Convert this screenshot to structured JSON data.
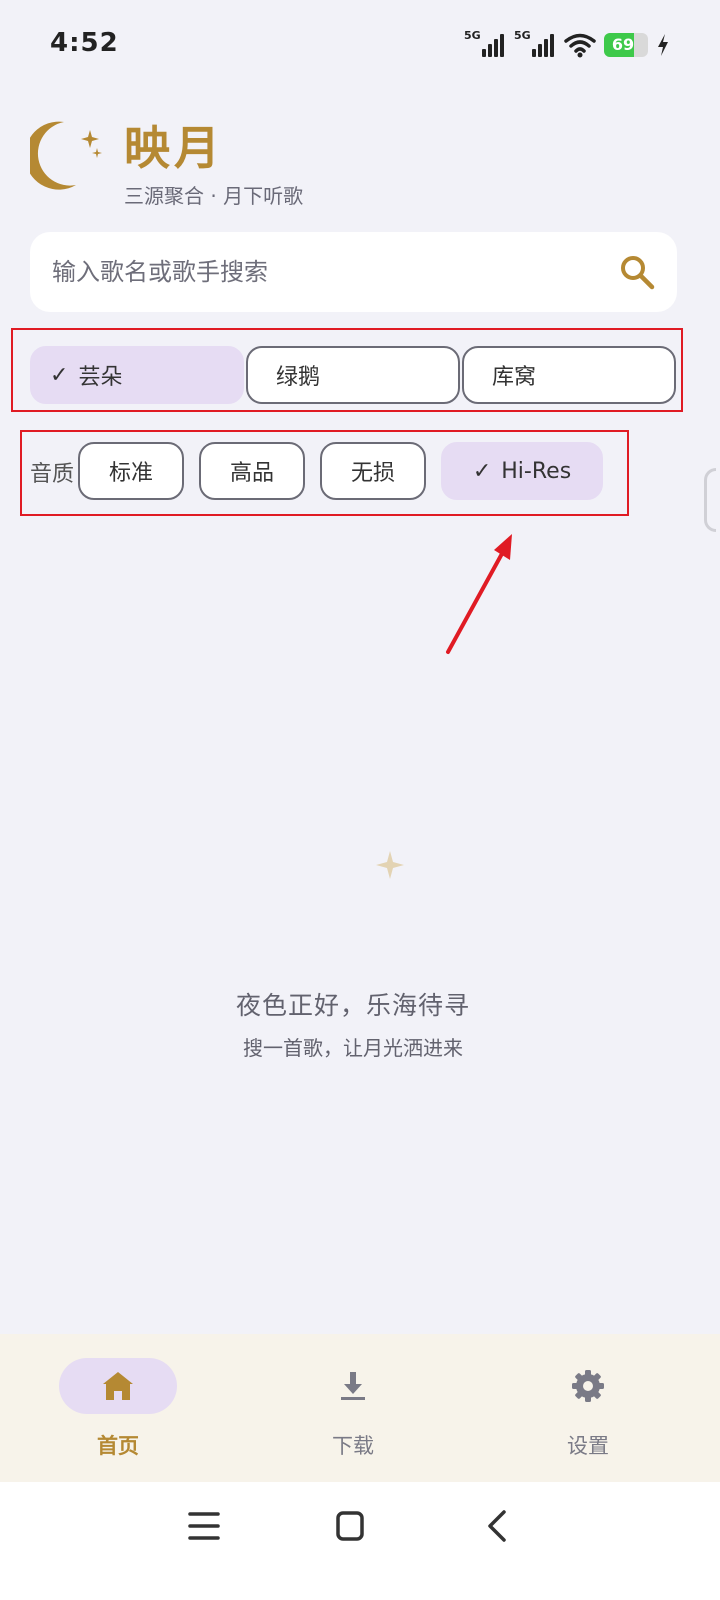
{
  "status_bar": {
    "time": "4:52",
    "signal_1_label": "5G",
    "signal_2_label": "5G",
    "battery_level": "69",
    "battery_fraction": 0.69,
    "icons": [
      "signal-icon",
      "signal-icon",
      "wifi-icon",
      "battery-icon",
      "charging-icon"
    ]
  },
  "header": {
    "title": "映月",
    "subtitle": "三源聚合 · 月下听歌",
    "logo_icon": "crescent-moon-icon"
  },
  "search": {
    "placeholder": "输入歌名或歌手搜索",
    "value": "",
    "icon": "search-icon"
  },
  "sources": [
    {
      "label": "芸朵",
      "selected": true
    },
    {
      "label": "绿鹅",
      "selected": false
    },
    {
      "label": "库窝",
      "selected": false
    }
  ],
  "quality": {
    "label": "音质",
    "options": [
      {
        "label": "标准",
        "selected": false
      },
      {
        "label": "高品",
        "selected": false
      },
      {
        "label": "无损",
        "selected": false
      },
      {
        "label": "Hi-Res",
        "selected": true
      }
    ]
  },
  "check_mark": "✓",
  "empty_state": {
    "title": "夜色正好，乐海待寻",
    "subtitle": "搜一首歌，让月光洒进来",
    "icon": "crescent-moon-icon"
  },
  "bottom_nav": {
    "items": [
      {
        "label": "首页",
        "icon": "home-icon",
        "active": true
      },
      {
        "label": "下载",
        "icon": "download-icon",
        "active": false
      },
      {
        "label": "设置",
        "icon": "gear-icon",
        "active": false
      }
    ]
  },
  "system_nav": [
    "menu-icon",
    "home-square-icon",
    "back-icon"
  ],
  "colors": {
    "accent": "#b58933",
    "chip_selected": "#e6dcf3",
    "highlight": "#e01b24",
    "background": "#f2f2f8",
    "nav_background": "#f7f3ea"
  }
}
